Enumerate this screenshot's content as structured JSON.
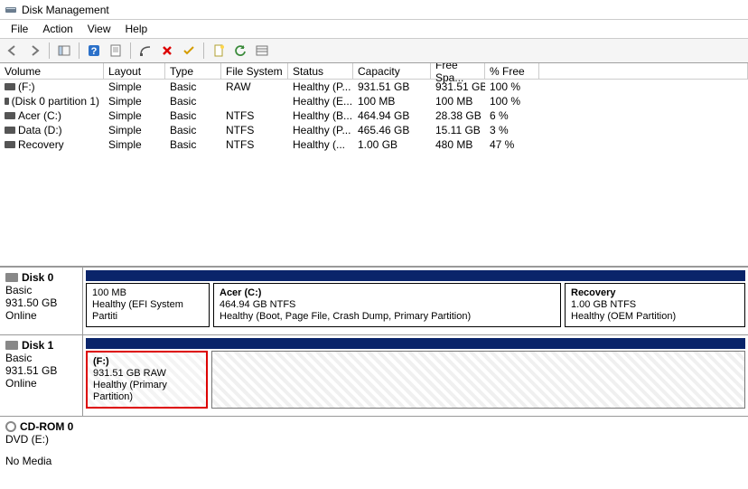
{
  "window": {
    "title": "Disk Management"
  },
  "menu": {
    "file": "File",
    "action": "Action",
    "view": "View",
    "help": "Help"
  },
  "toolbar": {
    "back": "back",
    "forward": "forward",
    "up": "up",
    "help": "help",
    "props": "properties",
    "script": "script",
    "delete": "delete",
    "check": "check",
    "new": "new",
    "refresh": "refresh",
    "list": "list"
  },
  "columns": {
    "volume": "Volume",
    "layout": "Layout",
    "type": "Type",
    "fs": "File System",
    "status": "Status",
    "capacity": "Capacity",
    "free": "Free Spa...",
    "pfree": "% Free"
  },
  "volumes": [
    {
      "name": "(F:)",
      "layout": "Simple",
      "type": "Basic",
      "fs": "RAW",
      "status": "Healthy (P...",
      "cap": "931.51 GB",
      "free": "931.51 GB",
      "pfree": "100 %"
    },
    {
      "name": "(Disk 0 partition 1)",
      "layout": "Simple",
      "type": "Basic",
      "fs": "",
      "status": "Healthy (E...",
      "cap": "100 MB",
      "free": "100 MB",
      "pfree": "100 %"
    },
    {
      "name": "Acer (C:)",
      "layout": "Simple",
      "type": "Basic",
      "fs": "NTFS",
      "status": "Healthy (B...",
      "cap": "464.94 GB",
      "free": "28.38 GB",
      "pfree": "6 %"
    },
    {
      "name": "Data (D:)",
      "layout": "Simple",
      "type": "Basic",
      "fs": "NTFS",
      "status": "Healthy (P...",
      "cap": "465.46 GB",
      "free": "15.11 GB",
      "pfree": "3 %"
    },
    {
      "name": "Recovery",
      "layout": "Simple",
      "type": "Basic",
      "fs": "NTFS",
      "status": "Healthy (...",
      "cap": "1.00 GB",
      "free": "480 MB",
      "pfree": "47 %"
    }
  ],
  "disks": {
    "d0": {
      "name": "Disk 0",
      "type": "Basic",
      "size": "931.50 GB",
      "state": "Online",
      "p1": {
        "name": "",
        "size": "100 MB",
        "status": "Healthy (EFI System Partiti"
      },
      "p2": {
        "name": "Acer  (C:)",
        "size": "464.94 GB NTFS",
        "status": "Healthy (Boot, Page File, Crash Dump, Primary Partition)"
      },
      "p3": {
        "name": "Recovery",
        "size": "1.00 GB NTFS",
        "status": "Healthy (OEM Partition)"
      }
    },
    "d1": {
      "name": "Disk 1",
      "type": "Basic",
      "size": "931.51 GB",
      "state": "Online",
      "p1": {
        "name": "(F:)",
        "size": "931.51 GB RAW",
        "status": "Healthy (Primary Partition)"
      }
    },
    "cd": {
      "name": "CD-ROM 0",
      "type": "DVD (E:)",
      "media": "No Media"
    }
  }
}
